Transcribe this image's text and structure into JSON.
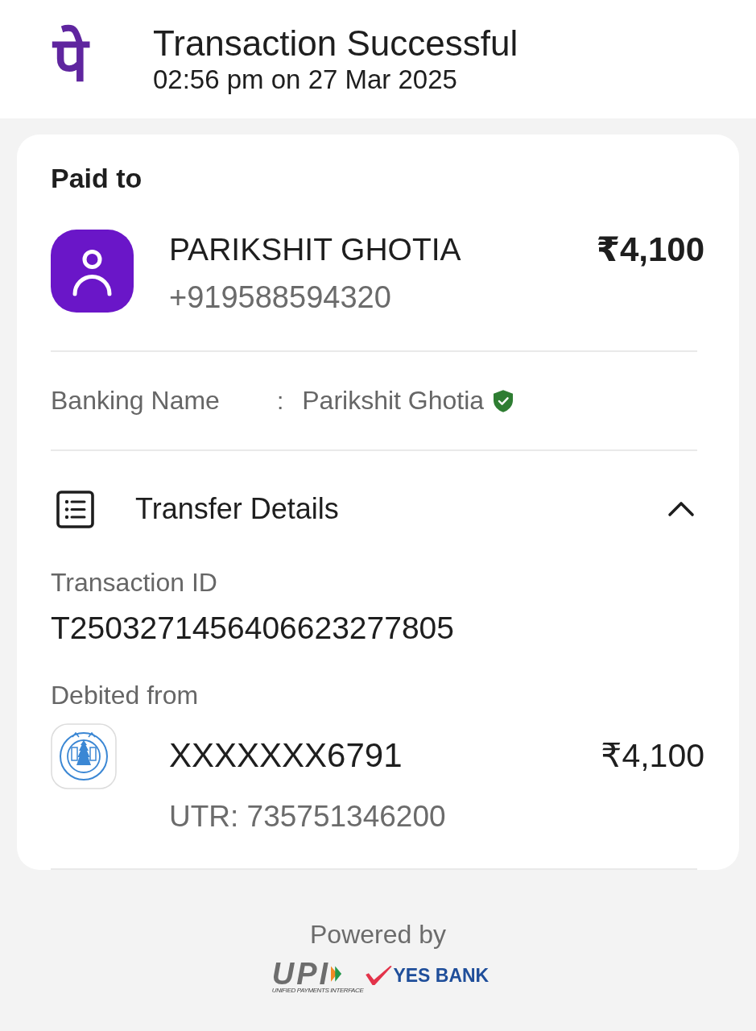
{
  "header": {
    "logo": "पे",
    "title": "Transaction Successful",
    "timestamp": "02:56 pm on 27 Mar 2025"
  },
  "paid_to": {
    "heading": "Paid to",
    "name": "PARIKSHIT GHOTIA",
    "phone": "+919588594320",
    "amount": "₹4,100",
    "banking_name": {
      "label": "Banking Name",
      "separator": ":",
      "value": "Parikshit Ghotia",
      "verified": true
    }
  },
  "transfer_details": {
    "title": "Transfer Details",
    "expanded": true,
    "transaction_id": {
      "label": "Transaction ID",
      "value": "T2503271456406623277805"
    },
    "debited_from": {
      "label": "Debited from",
      "account": "XXXXXXX6791",
      "amount": "₹4,100",
      "utr": "UTR: 735751346200"
    }
  },
  "footer": {
    "powered_by": "Powered by",
    "logos": [
      {
        "kind": "upi",
        "text": "UPI",
        "tagline": "UNIFIED PAYMENTS INTERFACE"
      },
      {
        "kind": "bank",
        "text": "YES BANK"
      }
    ]
  }
}
